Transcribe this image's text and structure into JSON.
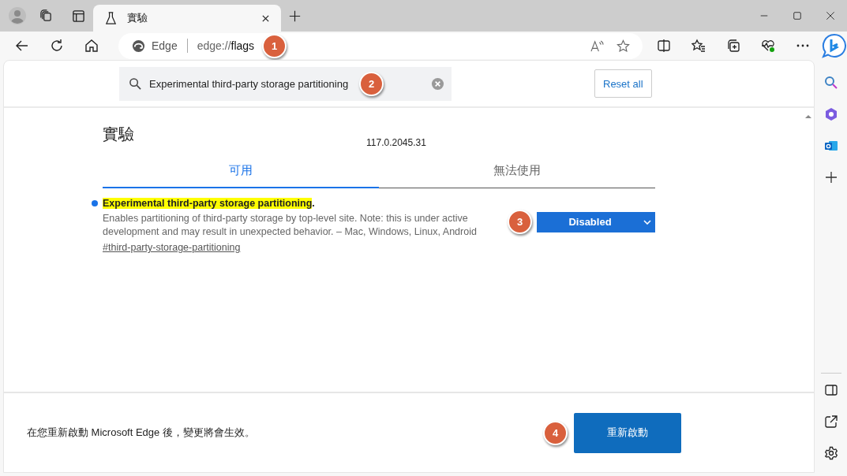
{
  "browser": {
    "tabs": [
      {
        "title": "實驗",
        "selected": true
      }
    ],
    "address": {
      "site_label": "Edge",
      "url_prefix": "edge://",
      "url_host": "flags",
      "callout": "1"
    }
  },
  "search": {
    "value": "Experimental third-party storage partitioning",
    "callout": "2"
  },
  "reset_button": "Reset all",
  "page": {
    "title": "實驗",
    "version": "117.0.2045.31",
    "tabs": [
      {
        "label": "可用",
        "selected": true
      },
      {
        "label": "無法使用",
        "selected": false
      }
    ]
  },
  "flags": [
    {
      "name": "Experimental third-party storage partitioning",
      "name_suffix": ".",
      "modified": true,
      "description": "Enables partitioning of third-party storage by top-level site. Note: this is under active development and may result in unexpected behavior. – Mac, Windows, Linux, Android",
      "link": "#third-party-storage-partitioning",
      "value": "Disabled",
      "callout": "3"
    }
  ],
  "footer": {
    "message": "在您重新啟動 Microsoft Edge 後，變更將會生效。",
    "button": "重新啟動",
    "callout": "4"
  }
}
